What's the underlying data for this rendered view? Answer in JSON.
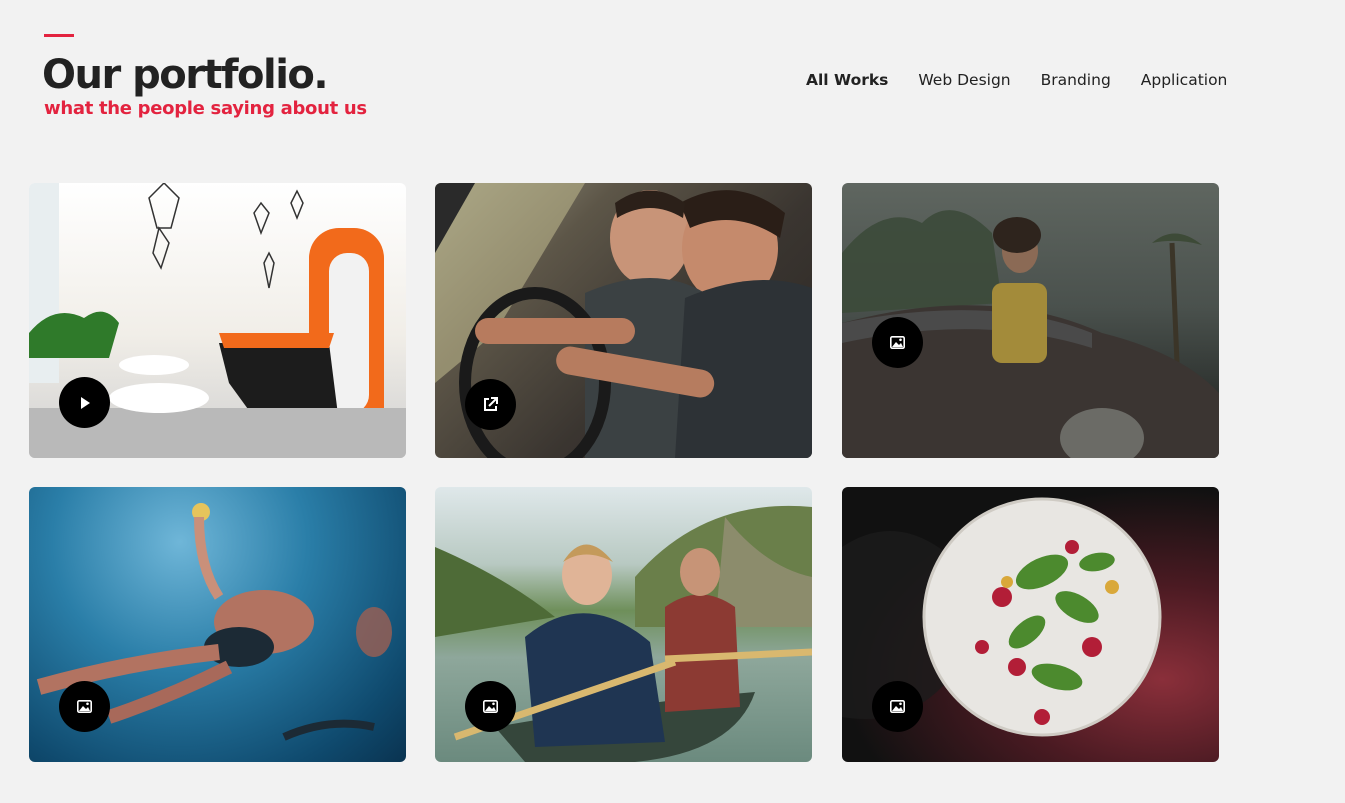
{
  "header": {
    "title": "Our portfolio.",
    "subtitle": "what the people saying about us"
  },
  "filters": [
    {
      "label": "All Works",
      "active": true
    },
    {
      "label": "Web Design",
      "active": false
    },
    {
      "label": "Branding",
      "active": false
    },
    {
      "label": "Application",
      "active": false
    }
  ],
  "portfolio": {
    "items": [
      {
        "scene": "office interior",
        "badge_icon": "play-icon"
      },
      {
        "scene": "two men driving a car",
        "badge_icon": "external-link-icon"
      },
      {
        "scene": "woman leaning on a vintage car",
        "badge_icon": "image-icon"
      },
      {
        "scene": "people swimming underwater",
        "badge_icon": "image-icon"
      },
      {
        "scene": "boy and man paddling a canoe",
        "badge_icon": "image-icon"
      },
      {
        "scene": "plated salad on dark background",
        "badge_icon": "image-icon"
      }
    ]
  },
  "colors": {
    "accent": "#e3233f",
    "background": "#f2f2f2",
    "text": "#222222",
    "badge": "#000000"
  }
}
